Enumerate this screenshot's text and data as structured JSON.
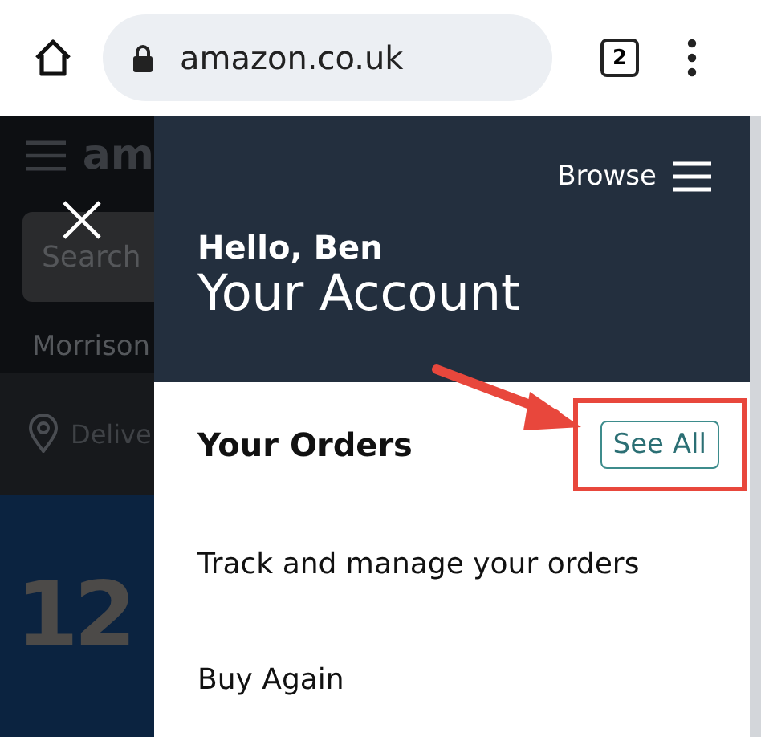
{
  "browser": {
    "url": "amazon.co.uk",
    "tab_count": "2"
  },
  "background": {
    "logo": "am",
    "search_placeholder": "Search",
    "location": "Morrison",
    "delivery": "Delive",
    "banner": "12"
  },
  "drawer": {
    "browse": "Browse",
    "greeting": "Hello, Ben",
    "title": "Your Account",
    "section": "Your Orders",
    "see_all": "See All",
    "items": [
      "Track and manage your orders",
      "Buy Again"
    ]
  }
}
